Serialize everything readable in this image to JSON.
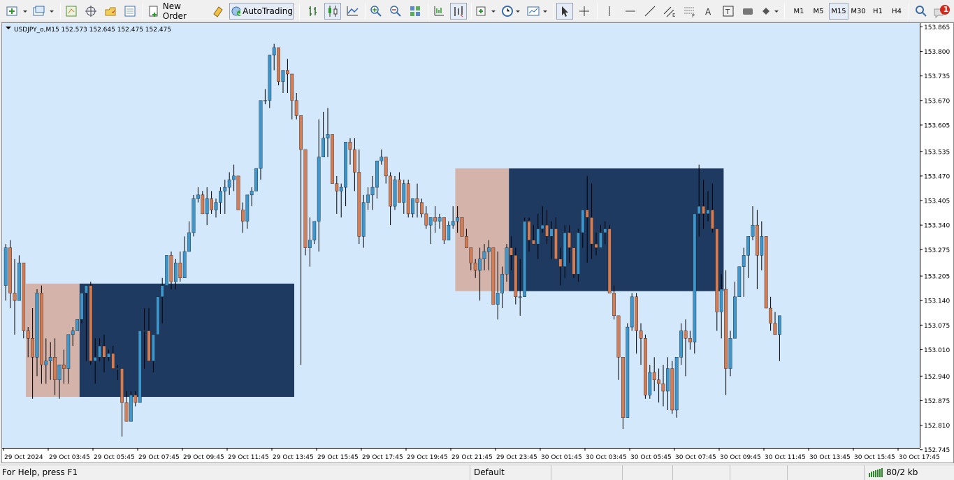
{
  "toolbar": {
    "new_order_label": "New Order",
    "autotrading_label": "AutoTrading",
    "timeframes": [
      "M1",
      "M5",
      "M15",
      "M30",
      "H1",
      "H4"
    ],
    "active_timeframe": "M15",
    "notification_count": "1"
  },
  "chart": {
    "header": "USDJPY_o,M15  152.573 152.645 152.475 152.475",
    "colors": {
      "background": "#d4e8fc",
      "bull": "#3d97cc",
      "bear": "#d47d55",
      "wick": "#000000",
      "zone_dark": "#1f3a60",
      "zone_light": "#d4b4aa"
    }
  },
  "chart_data": {
    "type": "candlestick",
    "symbol": "USDJPY_o",
    "timeframe": "M15",
    "ylim": [
      152.75,
      153.875
    ],
    "y_ticks": [
      "153.865",
      "153.800",
      "153.735",
      "153.670",
      "153.605",
      "153.535",
      "153.470",
      "153.405",
      "153.340",
      "153.275",
      "153.205",
      "153.140",
      "153.075",
      "153.010",
      "152.940",
      "152.875",
      "152.810",
      "152.745"
    ],
    "x_ticks": [
      "29 Oct 2024",
      "29 Oct 03:45",
      "29 Oct 05:45",
      "29 Oct 07:45",
      "29 Oct 09:45",
      "29 Oct 11:45",
      "29 Oct 13:45",
      "29 Oct 15:45",
      "29 Oct 17:45",
      "29 Oct 19:45",
      "29 Oct 21:45",
      "29 Oct 23:45",
      "30 Oct 01:45",
      "30 Oct 03:45",
      "30 Oct 05:45",
      "30 Oct 07:45",
      "30 Oct 09:45",
      "30 Oct 11:45",
      "30 Oct 13:45",
      "30 Oct 15:45",
      "30 Oct 17:45"
    ],
    "grid": false,
    "zones": [
      {
        "kind": "light",
        "start_index": 5,
        "end_index": 17,
        "top": 153.185,
        "bottom": 152.885
      },
      {
        "kind": "dark",
        "start_index": 17,
        "end_index": 65,
        "top": 153.185,
        "bottom": 152.885
      },
      {
        "kind": "light",
        "start_index": 101,
        "end_index": 113,
        "top": 153.49,
        "bottom": 153.165
      },
      {
        "kind": "dark",
        "start_index": 113,
        "end_index": 161,
        "top": 153.49,
        "bottom": 153.165
      }
    ],
    "ohlc": [
      [
        153.18,
        153.29,
        153.14,
        153.28
      ],
      [
        153.28,
        153.3,
        153.12,
        153.16
      ],
      [
        153.16,
        153.25,
        153.05,
        153.14
      ],
      [
        153.14,
        153.26,
        153.14,
        153.24
      ],
      [
        153.24,
        153.24,
        153.04,
        153.06
      ],
      [
        153.06,
        153.07,
        152.99,
        153.04
      ],
      [
        153.04,
        153.12,
        152.88,
        152.99
      ],
      [
        152.99,
        153.17,
        152.94,
        153.16
      ],
      [
        153.16,
        153.18,
        152.92,
        152.97
      ],
      [
        152.97,
        153.04,
        152.92,
        152.98
      ],
      [
        152.98,
        153.03,
        152.93,
        152.99
      ],
      [
        152.99,
        153.04,
        152.89,
        152.93
      ],
      [
        152.93,
        152.97,
        152.88,
        152.97
      ],
      [
        152.97,
        153.01,
        152.92,
        152.96
      ],
      [
        152.96,
        153.05,
        152.92,
        153.05
      ],
      [
        153.05,
        153.07,
        153.02,
        153.06
      ],
      [
        153.06,
        153.09,
        153.06,
        153.09
      ],
      [
        153.09,
        153.15,
        153.08,
        153.16
      ],
      [
        153.16,
        153.18,
        152.98,
        153.18
      ],
      [
        153.18,
        153.19,
        152.97,
        152.98
      ],
      [
        152.98,
        153.04,
        152.92,
        152.99
      ],
      [
        152.99,
        153.04,
        152.98,
        153.02
      ],
      [
        153.02,
        153.05,
        152.95,
        152.99
      ],
      [
        152.99,
        153.01,
        152.98,
        153.0
      ],
      [
        153.0,
        153.02,
        152.96,
        152.96
      ],
      [
        152.96,
        152.97,
        152.93,
        152.96
      ],
      [
        152.96,
        152.96,
        152.78,
        152.87
      ],
      [
        152.87,
        152.9,
        152.82,
        152.82
      ],
      [
        152.82,
        152.9,
        152.83,
        152.89
      ],
      [
        152.89,
        152.9,
        152.86,
        152.87
      ],
      [
        152.87,
        153.06,
        152.87,
        153.06
      ],
      [
        153.06,
        153.12,
        152.96,
        153.06
      ],
      [
        153.06,
        153.12,
        152.99,
        152.98
      ],
      [
        152.98,
        153.05,
        152.95,
        153.05
      ],
      [
        153.05,
        153.15,
        153.05,
        153.15
      ],
      [
        153.15,
        153.2,
        153.08,
        153.18
      ],
      [
        153.18,
        153.26,
        153.21,
        153.26
      ],
      [
        153.26,
        153.27,
        153.17,
        153.19
      ],
      [
        153.19,
        153.25,
        153.17,
        153.24
      ],
      [
        153.24,
        153.27,
        153.19,
        153.2
      ],
      [
        153.2,
        153.31,
        153.2,
        153.27
      ],
      [
        153.27,
        153.35,
        153.27,
        153.32
      ],
      [
        153.32,
        153.42,
        153.31,
        153.41
      ],
      [
        153.41,
        153.44,
        153.4,
        153.42
      ],
      [
        153.42,
        153.43,
        153.37,
        153.37
      ],
      [
        153.37,
        153.44,
        153.34,
        153.41
      ],
      [
        153.41,
        153.43,
        153.37,
        153.38
      ],
      [
        153.38,
        153.41,
        153.36,
        153.4
      ],
      [
        153.4,
        153.44,
        153.37,
        153.43
      ],
      [
        153.43,
        153.46,
        153.37,
        153.44
      ],
      [
        153.44,
        153.48,
        153.42,
        153.46
      ],
      [
        153.46,
        153.5,
        153.43,
        153.47
      ],
      [
        153.47,
        153.45,
        153.38,
        153.38
      ],
      [
        153.38,
        153.4,
        153.32,
        153.35
      ],
      [
        153.35,
        153.42,
        153.33,
        153.42
      ],
      [
        153.42,
        153.44,
        153.39,
        153.43
      ],
      [
        153.43,
        153.48,
        153.43,
        153.49
      ],
      [
        153.49,
        153.67,
        153.46,
        153.67
      ],
      [
        153.67,
        153.7,
        153.66,
        153.67
      ],
      [
        153.67,
        153.79,
        153.65,
        153.79
      ],
      [
        153.79,
        153.82,
        153.75,
        153.81
      ],
      [
        153.81,
        153.79,
        153.71,
        153.72
      ],
      [
        153.72,
        153.74,
        153.69,
        153.75
      ],
      [
        153.75,
        153.78,
        153.69,
        153.74
      ],
      [
        153.74,
        153.74,
        153.62,
        153.67
      ],
      [
        153.67,
        153.69,
        153.62,
        153.63
      ],
      [
        153.63,
        153.63,
        152.97,
        153.54
      ],
      [
        153.54,
        153.54,
        153.26,
        153.28
      ],
      [
        153.28,
        153.36,
        153.23,
        153.3
      ],
      [
        153.3,
        153.35,
        153.29,
        153.35
      ],
      [
        153.35,
        153.62,
        153.27,
        153.52
      ],
      [
        153.52,
        153.64,
        153.52,
        153.57
      ],
      [
        153.57,
        153.65,
        153.52,
        153.58
      ],
      [
        153.58,
        153.58,
        153.51,
        153.45
      ],
      [
        153.45,
        153.47,
        153.37,
        153.43
      ],
      [
        153.43,
        153.45,
        153.36,
        153.44
      ],
      [
        153.44,
        153.56,
        153.39,
        153.56
      ],
      [
        153.56,
        153.57,
        153.5,
        153.54
      ],
      [
        153.54,
        153.57,
        153.43,
        153.48
      ],
      [
        153.48,
        153.54,
        153.29,
        153.31
      ],
      [
        153.31,
        153.42,
        153.28,
        153.4
      ],
      [
        153.4,
        153.44,
        153.38,
        153.42
      ],
      [
        153.42,
        153.47,
        153.38,
        153.44
      ],
      [
        153.44,
        153.5,
        153.41,
        153.51
      ],
      [
        153.51,
        153.54,
        153.5,
        153.52
      ],
      [
        153.52,
        153.49,
        153.45,
        153.47
      ],
      [
        153.47,
        153.48,
        153.34,
        153.39
      ],
      [
        153.39,
        153.47,
        153.38,
        153.46
      ],
      [
        153.46,
        153.48,
        153.42,
        153.4
      ],
      [
        153.4,
        153.46,
        153.37,
        153.45
      ],
      [
        153.45,
        153.46,
        153.36,
        153.37
      ],
      [
        153.37,
        153.38,
        153.36,
        153.41
      ],
      [
        153.41,
        153.45,
        153.36,
        153.4
      ],
      [
        153.4,
        153.41,
        153.36,
        153.37
      ],
      [
        153.37,
        153.39,
        153.33,
        153.34
      ],
      [
        153.34,
        153.36,
        153.29,
        153.36
      ],
      [
        153.36,
        153.39,
        153.32,
        153.35
      ],
      [
        153.35,
        153.37,
        153.33,
        153.36
      ],
      [
        153.36,
        153.35,
        153.29,
        153.3
      ],
      [
        153.3,
        153.35,
        153.3,
        153.34
      ],
      [
        153.34,
        153.39,
        153.33,
        153.35
      ],
      [
        153.35,
        153.39,
        153.32,
        153.36
      ],
      [
        153.36,
        153.34,
        153.31,
        153.31
      ],
      [
        153.31,
        153.33,
        153.28,
        153.28
      ],
      [
        153.28,
        153.27,
        153.22,
        153.24
      ],
      [
        153.24,
        153.25,
        153.2,
        153.22
      ],
      [
        153.22,
        153.28,
        153.14,
        153.25
      ],
      [
        153.25,
        153.29,
        153.22,
        153.27
      ],
      [
        153.27,
        153.3,
        153.22,
        153.28
      ],
      [
        153.28,
        153.21,
        153.13,
        153.13
      ],
      [
        153.13,
        153.27,
        153.09,
        153.16
      ],
      [
        153.16,
        153.23,
        153.12,
        153.21
      ],
      [
        153.21,
        153.29,
        153.19,
        153.28
      ],
      [
        153.28,
        153.31,
        153.22,
        153.26
      ],
      [
        153.26,
        153.28,
        153.13,
        153.15
      ],
      [
        153.15,
        153.25,
        153.1,
        153.15
      ],
      [
        153.15,
        153.36,
        153.25,
        153.35
      ],
      [
        153.35,
        153.36,
        153.27,
        153.3
      ],
      [
        153.3,
        153.34,
        153.29,
        153.29
      ],
      [
        153.29,
        153.37,
        153.25,
        153.33
      ],
      [
        153.33,
        153.39,
        153.32,
        153.34
      ],
      [
        153.34,
        153.38,
        153.29,
        153.31
      ],
      [
        153.31,
        153.35,
        153.25,
        153.33
      ],
      [
        153.33,
        153.36,
        153.27,
        153.25
      ],
      [
        153.25,
        153.28,
        153.18,
        153.23
      ],
      [
        153.23,
        153.34,
        153.2,
        153.32
      ],
      [
        153.32,
        153.34,
        153.24,
        153.28
      ],
      [
        153.28,
        153.22,
        153.2,
        153.21
      ],
      [
        153.21,
        153.33,
        153.19,
        153.32
      ],
      [
        153.32,
        153.37,
        153.28,
        153.38
      ],
      [
        153.38,
        153.47,
        153.24,
        153.36
      ],
      [
        153.36,
        153.45,
        153.25,
        153.29
      ],
      [
        153.29,
        153.32,
        153.26,
        153.28
      ],
      [
        153.28,
        153.34,
        153.29,
        153.32
      ],
      [
        153.32,
        153.35,
        153.29,
        153.33
      ],
      [
        153.33,
        153.34,
        153.16,
        153.16
      ],
      [
        153.16,
        153.18,
        153.09,
        153.1
      ],
      [
        153.1,
        153.04,
        152.93,
        152.99
      ],
      [
        152.99,
        152.97,
        152.8,
        152.83
      ],
      [
        152.83,
        153.08,
        152.84,
        153.07
      ],
      [
        153.07,
        153.16,
        153.06,
        153.15
      ],
      [
        153.15,
        153.16,
        153.0,
        153.06
      ],
      [
        153.06,
        153.08,
        152.97,
        153.04
      ],
      [
        153.04,
        153.05,
        152.88,
        152.89
      ],
      [
        152.89,
        152.97,
        152.88,
        152.95
      ],
      [
        152.95,
        152.99,
        152.9,
        152.93
      ],
      [
        152.93,
        152.96,
        152.87,
        152.92
      ],
      [
        152.92,
        152.97,
        152.86,
        152.9
      ],
      [
        152.9,
        152.99,
        152.85,
        152.96
      ],
      [
        152.96,
        152.98,
        152.84,
        152.85
      ],
      [
        152.85,
        152.99,
        152.83,
        152.99
      ],
      [
        152.99,
        153.08,
        152.97,
        153.06
      ],
      [
        153.06,
        153.09,
        152.94,
        153.04
      ],
      [
        153.04,
        153.06,
        153.01,
        153.03
      ],
      [
        153.03,
        153.37,
        153.0,
        153.37
      ],
      [
        153.37,
        153.5,
        153.31,
        153.39
      ],
      [
        153.39,
        153.46,
        153.33,
        153.37
      ],
      [
        153.37,
        153.43,
        153.35,
        153.38
      ],
      [
        153.38,
        153.45,
        153.32,
        153.33
      ],
      [
        153.33,
        153.31,
        153.06,
        153.11
      ],
      [
        153.11,
        153.21,
        153.04,
        153.17
      ],
      [
        153.17,
        153.22,
        152.89,
        152.96
      ],
      [
        152.96,
        153.06,
        152.94,
        153.04
      ],
      [
        153.04,
        153.19,
        153.07,
        153.15
      ],
      [
        153.15,
        153.21,
        153.15,
        153.23
      ],
      [
        153.23,
        153.28,
        153.15,
        153.26
      ],
      [
        153.26,
        153.29,
        153.2,
        153.31
      ],
      [
        153.31,
        153.39,
        153.3,
        153.34
      ],
      [
        153.34,
        153.38,
        153.17,
        153.26
      ],
      [
        153.26,
        153.35,
        153.22,
        153.31
      ],
      [
        153.31,
        153.27,
        153.12,
        153.12
      ],
      [
        153.12,
        153.15,
        153.06,
        153.08
      ],
      [
        153.08,
        153.11,
        153.06,
        153.05
      ],
      [
        153.05,
        153.09,
        152.98,
        153.1
      ]
    ]
  },
  "status": {
    "help": "For Help, press F1",
    "profile": "Default",
    "traffic": "80/2 kb"
  }
}
